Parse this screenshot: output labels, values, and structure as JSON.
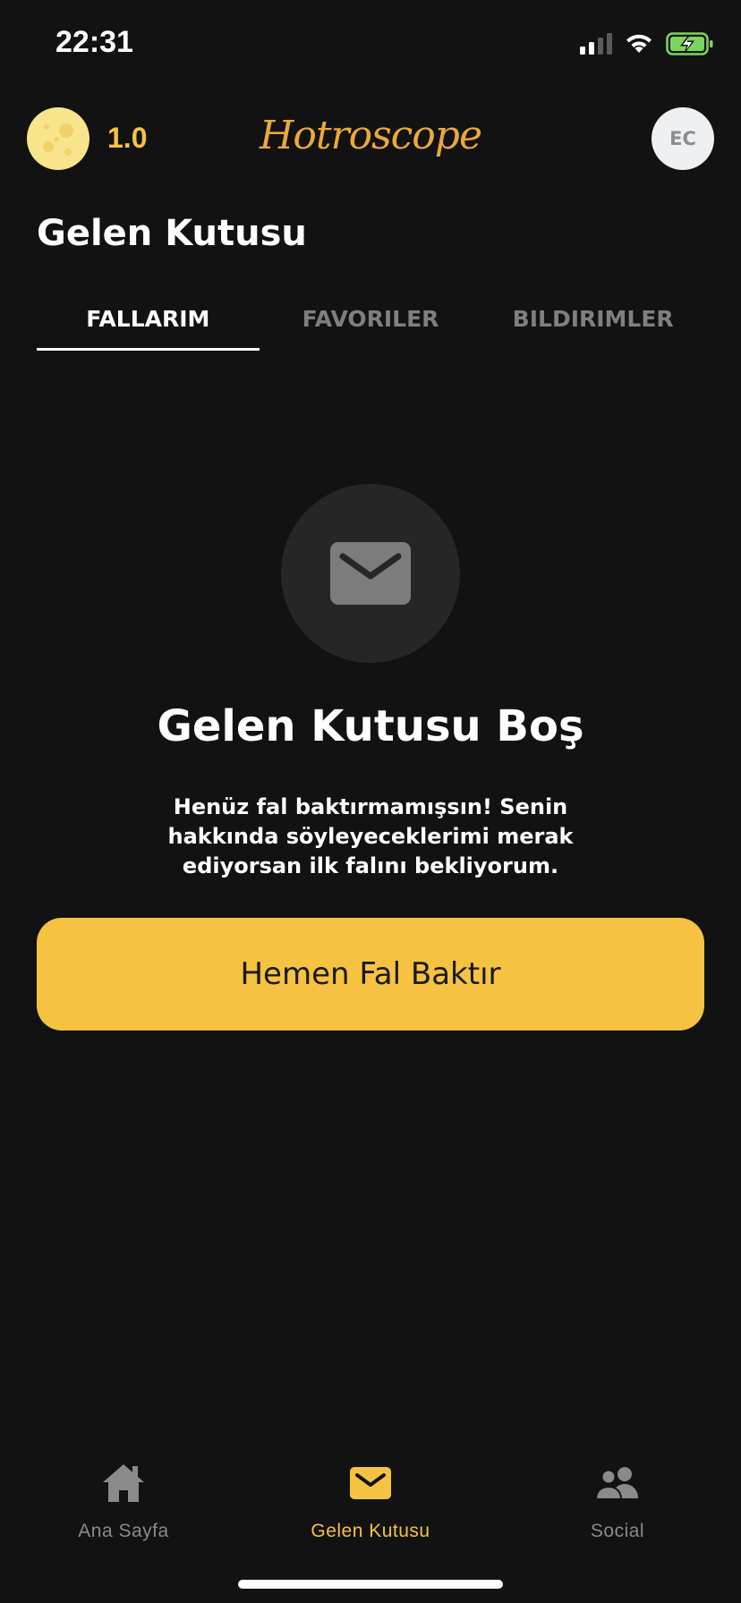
{
  "status_bar": {
    "time": "22:31",
    "icons": [
      "signal-icon",
      "wifi-icon",
      "battery-charging-icon"
    ]
  },
  "header": {
    "moon_value": "1.0",
    "logo": "Hotroscope",
    "avatar_initials": "EC"
  },
  "page_title": "Gelen Kutusu",
  "tabs": [
    {
      "label": "FALLARIM",
      "active": true
    },
    {
      "label": "FAVORILER",
      "active": false
    },
    {
      "label": "BILDIRIMLER",
      "active": false
    }
  ],
  "empty_state": {
    "icon": "envelope-icon",
    "title": "Gelen Kutusu Boş",
    "description": "Henüz fal baktırmamışsın! Senin hakkında söyleyeceklerimi merak ediyorsan ilk falını bekliyorum.",
    "button_label": "Hemen Fal Baktır"
  },
  "bottom_nav": [
    {
      "label": "Ana Sayfa",
      "icon": "home-icon",
      "active": false
    },
    {
      "label": "Gelen Kutusu",
      "icon": "envelope-icon",
      "active": true
    },
    {
      "label": "Social",
      "icon": "people-icon",
      "active": false
    }
  ],
  "colors": {
    "background": "#121212",
    "accent": "#f5c242",
    "logo": "#e9a93a",
    "inactive": "#8a8a8a"
  }
}
